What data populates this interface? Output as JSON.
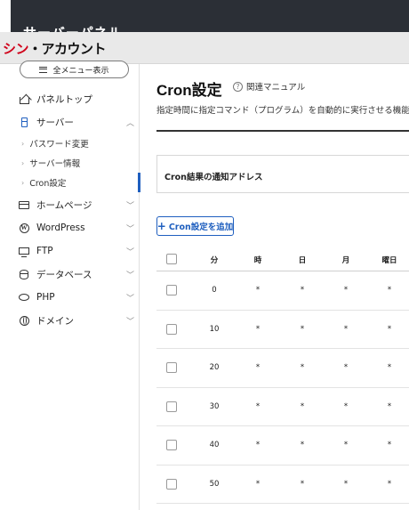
{
  "topbar": {
    "title": "サーバーパネル"
  },
  "brand": {
    "part1": "シン",
    "part2": "・アカウント"
  },
  "sidebar": {
    "menu_button": "全メニュー表示",
    "items": [
      {
        "label": "パネルトップ",
        "icon": "home-icon"
      },
      {
        "label": "サーバー",
        "icon": "server-icon",
        "expanded": true
      },
      {
        "label": "ホームページ",
        "icon": "page-icon"
      },
      {
        "label": "WordPress",
        "icon": "wordpress-icon"
      },
      {
        "label": "FTP",
        "icon": "ftp-icon"
      },
      {
        "label": "データベース",
        "icon": "database-icon"
      },
      {
        "label": "PHP",
        "icon": "php-icon"
      },
      {
        "label": "ドメイン",
        "icon": "globe-icon"
      }
    ],
    "sub_items": [
      {
        "label": "パスワード変更"
      },
      {
        "label": "サーバー情報"
      },
      {
        "label": "Cron設定",
        "active": true
      }
    ]
  },
  "main": {
    "title": "Cron設定",
    "manual_link": "関連マニュアル",
    "description": "指定時間に指定コマンド（プログラム）を自動的に実行させる機能のこ",
    "notify_label": "Cron結果の通知アドレス",
    "add_button": "Cron設定を追加",
    "table": {
      "headers": [
        "分",
        "時",
        "日",
        "月",
        "曜日"
      ],
      "rows": [
        [
          "0",
          "*",
          "*",
          "*",
          "*"
        ],
        [
          "10",
          "*",
          "*",
          "*",
          "*"
        ],
        [
          "20",
          "*",
          "*",
          "*",
          "*"
        ],
        [
          "30",
          "*",
          "*",
          "*",
          "*"
        ],
        [
          "40",
          "*",
          "*",
          "*",
          "*"
        ],
        [
          "50",
          "*",
          "*",
          "*",
          "*"
        ]
      ]
    }
  },
  "colors": {
    "accent": "#1f5fbf",
    "brand_red": "#d0021b",
    "topbar": "#2b2f36"
  }
}
